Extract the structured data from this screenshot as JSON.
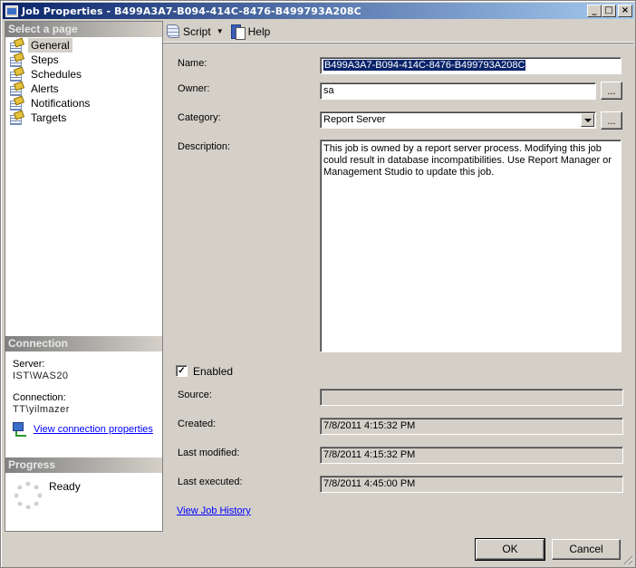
{
  "window": {
    "title": "Job Properties - B499A3A7-B094-414C-8476-B499793A208C",
    "controls": {
      "minimize": "_",
      "maximize": "□",
      "close": "×"
    }
  },
  "left_panel": {
    "select_page_header": "Select a page",
    "pages": [
      {
        "label": "General",
        "icon": "page-icon",
        "selected": true
      },
      {
        "label": "Steps",
        "icon": "page-icon",
        "selected": false
      },
      {
        "label": "Schedules",
        "icon": "page-icon",
        "selected": false
      },
      {
        "label": "Alerts",
        "icon": "page-icon",
        "selected": false
      },
      {
        "label": "Notifications",
        "icon": "page-icon",
        "selected": false
      },
      {
        "label": "Targets",
        "icon": "page-icon",
        "selected": false
      }
    ],
    "connection": {
      "header": "Connection",
      "server_label": "Server:",
      "server_value": "IST\\WAS20",
      "connection_label": "Connection:",
      "connection_value": "TT\\yilmazer",
      "view_properties_link": "View connection properties"
    },
    "progress": {
      "header": "Progress",
      "status": "Ready"
    }
  },
  "toolbar": {
    "script_label": "Script",
    "script_dropdown_arrow": "▼",
    "help_label": "Help"
  },
  "form": {
    "name_label": "Name:",
    "name_value": "B499A3A7-B094-414C-8476-B499793A208C",
    "owner_label": "Owner:",
    "owner_value": "sa",
    "owner_browse": "...",
    "category_label": "Category:",
    "category_value": "Report Server",
    "category_browse": "...",
    "description_label": "Description:",
    "description_value": "This job is owned by a report server process. Modifying this job could result in database incompatibilities. Use Report Manager or Management Studio to update this job.",
    "enabled_label": "Enabled",
    "enabled_checked": true,
    "enabled_mark": "✓",
    "source_label": "Source:",
    "source_value": "",
    "created_label": "Created:",
    "created_value": "7/8/2011 4:15:32 PM",
    "last_modified_label": "Last modified:",
    "last_modified_value": "7/8/2011 4:15:32 PM",
    "last_executed_label": "Last executed:",
    "last_executed_value": "7/8/2011 4:45:00 PM",
    "view_history_link": "View Job History"
  },
  "footer": {
    "ok_label": "OK",
    "cancel_label": "Cancel"
  }
}
